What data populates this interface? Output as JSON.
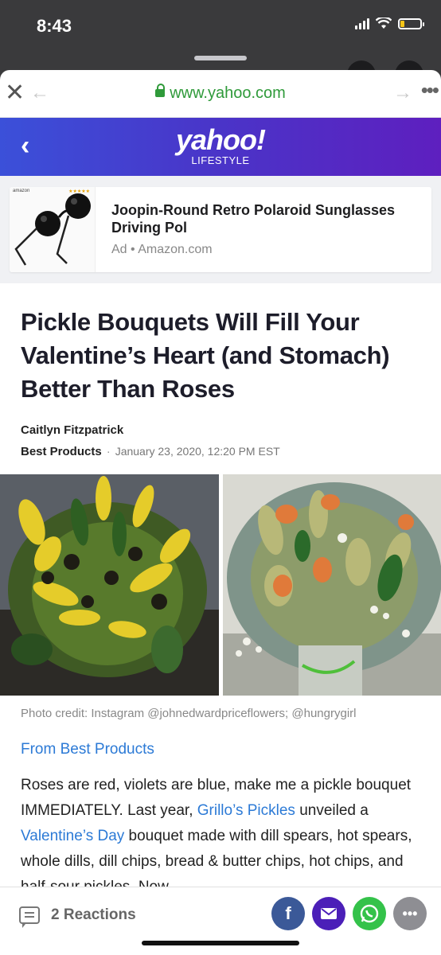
{
  "status_bar": {
    "time": "8:43",
    "battery_level": 0.2
  },
  "browser": {
    "url": "www.yahoo.com"
  },
  "header": {
    "logo": "yahoo!",
    "section": "LIFESTYLE"
  },
  "ad": {
    "thumb_brand": "amazon",
    "title": "Joopin-Round Retro Polaroid Sunglasses Driving Pol",
    "ad_label": "Ad",
    "source": "Amazon.com"
  },
  "article": {
    "headline": "Pickle Bouquets Will Fill Your Valentine’s Heart (and Stomach) Better Than Roses",
    "author": "Caitlyn Fitzpatrick",
    "source": "Best Products",
    "date": "January 23, 2020, 12:20 PM EST",
    "photo_credit": "Photo credit: Instagram @johnedwardpriceflowers; @hungrygirl",
    "from_link": "From Best Products",
    "body": {
      "t1": "Roses are red, violets are blue, make me a pickle bouquet IMMEDIATELY. Last year, ",
      "link1": "Grillo’s Pickles",
      "t2": " unveiled a ",
      "link2": "Valentine’s Day",
      "t3": " bouquet made with dill spears, hot spears, whole dills, dill chips, bread & butter chips, hot chips, and half-sour pickles. Now"
    }
  },
  "bottom_bar": {
    "reactions_label": "2 Reactions"
  },
  "colors": {
    "yahoo_purple": "#5e1fbf",
    "link_blue": "#2c7ad6",
    "facebook": "#3b5998",
    "whatsapp": "#34c24a"
  }
}
